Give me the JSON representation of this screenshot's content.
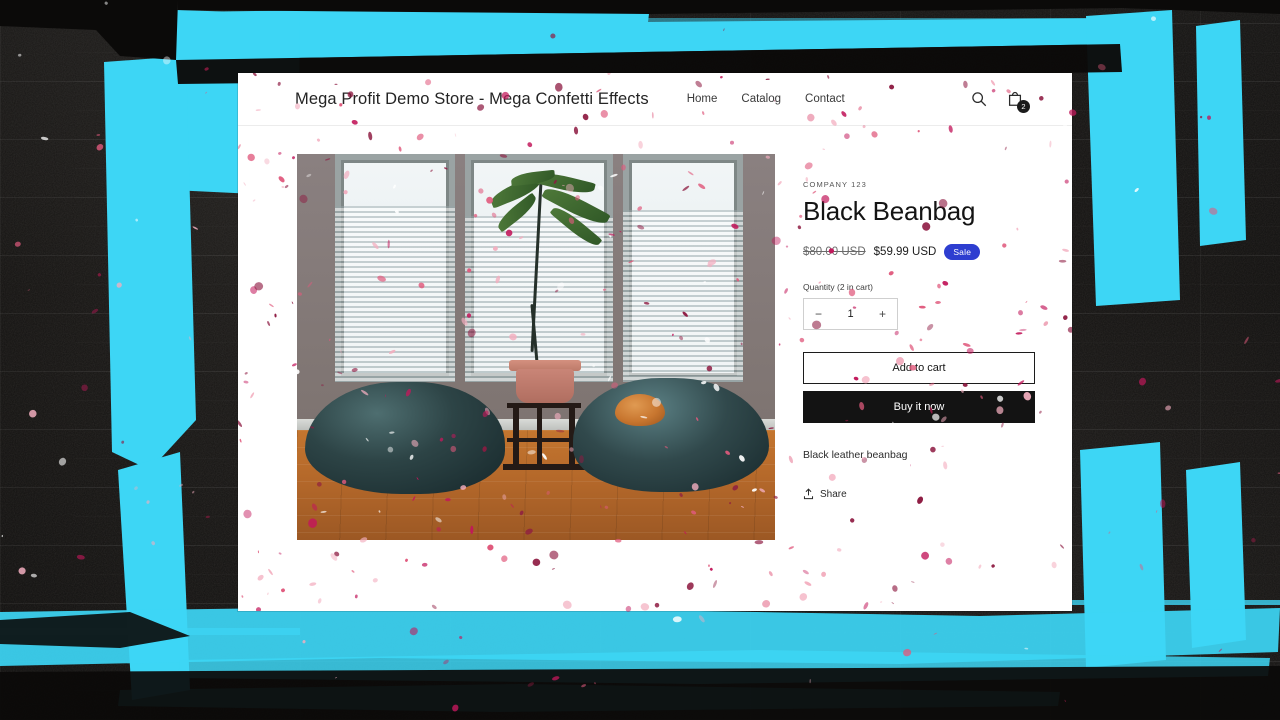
{
  "background": {
    "style_name": "dark-brick-wall",
    "brush_color": "#3dd6f5",
    "wall_color": "#0c0b0a"
  },
  "site": {
    "store_title": "Mega Profit Demo Store - Mega Confetti Effects",
    "nav": [
      {
        "label": "Home"
      },
      {
        "label": "Catalog"
      },
      {
        "label": "Contact"
      }
    ],
    "actions": {
      "search_icon": "search-icon",
      "cart_icon": "cart-icon",
      "cart_count": "2"
    }
  },
  "product": {
    "vendor": "COMPANY 123",
    "title": "Black Beanbag",
    "price_old": "$80.00 USD",
    "price_new": "$59.99 USD",
    "sale_badge": "Sale",
    "sale_badge_color": "#2e3ed0",
    "quantity_label": "Quantity (2 in cart)",
    "quantity_value": "1",
    "decrease_label": "−",
    "increase_label": "+",
    "add_to_cart_label": "Add to cart",
    "buy_now_label": "Buy it now",
    "description": "Black leather beanbag",
    "share_label": "Share",
    "share_icon": "share-icon",
    "image_alt": "Two dark teal beanbags in a room with tall windows, a potted plant and an orange cat"
  },
  "effects": {
    "confetti_colors": [
      "#c2185b",
      "#e05a7d",
      "#f3aebf",
      "#ffffff",
      "#8e1b42"
    ]
  }
}
